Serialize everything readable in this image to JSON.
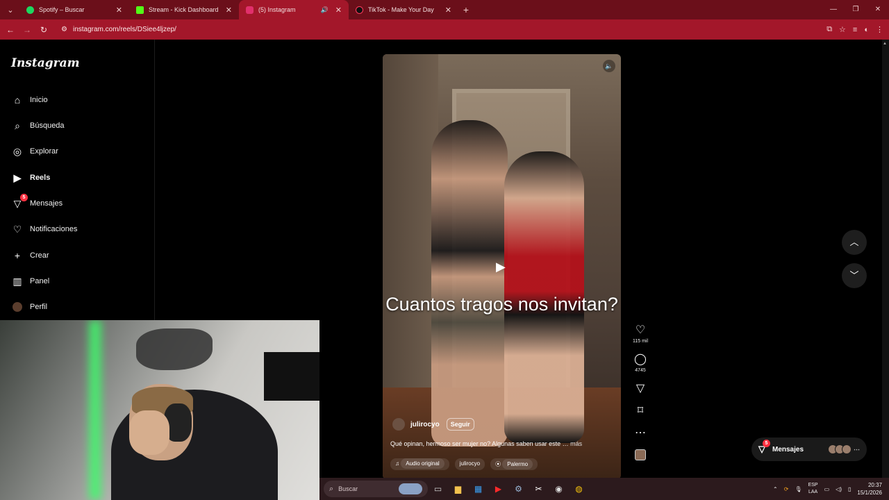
{
  "browser": {
    "tabs": [
      {
        "title": "Spotify – Buscar",
        "favicon_color": "#1ed760",
        "active": false
      },
      {
        "title": "Stream - Kick Dashboard",
        "favicon_color": "#53fc18",
        "active": false
      },
      {
        "title": "(5) Instagram",
        "favicon_color": "#e1306c",
        "active": true
      },
      {
        "title": "TikTok - Make Your Day",
        "favicon_color": "#000000",
        "active": false
      }
    ],
    "url": "instagram.com/reels/DSiee4ljzep/"
  },
  "instagram": {
    "logo": "Instagram",
    "nav": [
      {
        "label": "Inicio",
        "icon": "home-icon"
      },
      {
        "label": "Búsqueda",
        "icon": "search-icon"
      },
      {
        "label": "Explorar",
        "icon": "compass-icon"
      },
      {
        "label": "Reels",
        "icon": "reels-icon"
      },
      {
        "label": "Mensajes",
        "icon": "messenger-icon",
        "badge": "5"
      },
      {
        "label": "Notificaciones",
        "icon": "heart-icon"
      },
      {
        "label": "Crear",
        "icon": "plus-icon"
      },
      {
        "label": "Panel",
        "icon": "chart-icon"
      },
      {
        "label": "Perfil",
        "icon": "avatar-icon"
      }
    ],
    "reel": {
      "caption": "Cuantos tragos nos invitan?",
      "username": "julirocyo",
      "follow_label": "Seguir",
      "description": "Qué opinan, hermoso ser mujer no? Algunas saben usar este …",
      "more_label": "más",
      "audio_label": "Audio original",
      "audio_user": "julirocyo",
      "location": "Palermo"
    },
    "actions": {
      "likes": "115 mil",
      "comments": "4745"
    },
    "messages_pill": {
      "label": "Mensajes",
      "badge": "5"
    }
  },
  "taskbar": {
    "search_placeholder": "Buscar",
    "lang_top": "ESP",
    "lang_bottom": "LAA",
    "time": "20:37",
    "date": "15/1/2026"
  }
}
